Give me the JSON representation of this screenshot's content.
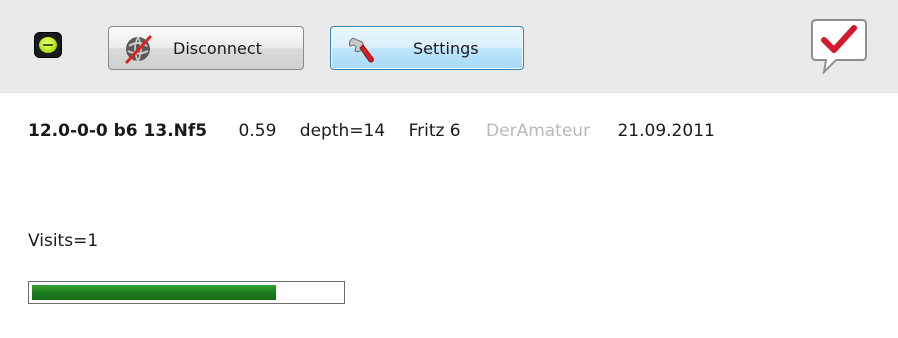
{
  "toolbar": {
    "status_icon": "status-led-icon",
    "status_color": "#c6ef2a",
    "disconnect": {
      "label": "Disconnect",
      "icon": "disconnect-globe-icon"
    },
    "settings": {
      "label": "Settings",
      "icon": "wrench-icon"
    },
    "notify_icon": "checkmark-speech-bubble-icon"
  },
  "analysis": {
    "move_text": "12.0-0-0 b6 13.Nf5",
    "evaluation": "0.59",
    "depth": "depth=14",
    "engine": "Fritz 6",
    "user": "DerAmateur",
    "date": "21.09.2011"
  },
  "visits": {
    "label": "Visits=1"
  },
  "progress": {
    "fraction": 0.79,
    "color": "#1d7d1d"
  }
}
